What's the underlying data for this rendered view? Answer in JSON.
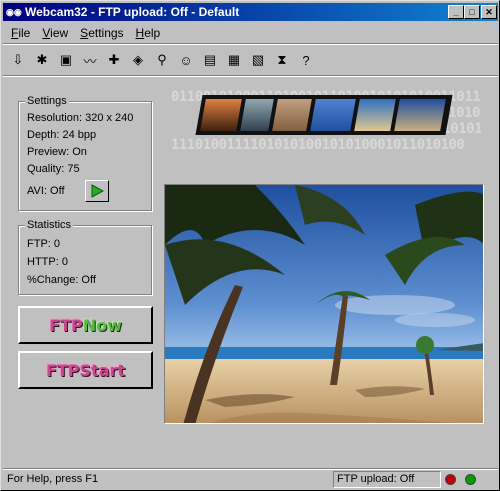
{
  "window": {
    "title": "Webcam32 - FTP upload: Off - Default"
  },
  "title_buttons": {
    "minimize": "_",
    "maximize": "□",
    "close": "✕"
  },
  "menu": {
    "items": [
      {
        "underline": "F",
        "rest": "ile"
      },
      {
        "underline": "V",
        "rest": "iew"
      },
      {
        "underline": "S",
        "rest": "ettings"
      },
      {
        "underline": "H",
        "rest": "elp"
      }
    ]
  },
  "toolbar": {
    "icons": [
      "download-icon",
      "bluetooth-icon",
      "save-icon",
      "wave-icon",
      "plus-cross-icon",
      "palette-icon",
      "magnifier-icon",
      "smiley-icon",
      "edit-icon",
      "filmstrip-icon",
      "screen-icon",
      "hourglass-icon",
      "help-icon"
    ],
    "glyphs": [
      "⇩",
      "✱",
      "▣",
      "〰",
      "✚",
      "◈",
      "⚲",
      "☺",
      "▤",
      "▦",
      "▧",
      "⧗",
      "?"
    ]
  },
  "settings": {
    "label": "Settings",
    "resolution": "Resolution: 320 x 240",
    "depth": "Depth: 24 bpp",
    "preview": "Preview: On",
    "quality": "Quality: 75",
    "avi": "AVI: Off"
  },
  "statistics": {
    "label": "Statistics",
    "ftp": "FTP: 0",
    "http": "HTTP: 0",
    "change": "%Change: Off"
  },
  "buttons": {
    "ftp_now_a": "FTP ",
    "ftp_now_b": "Now",
    "ftp_start_a": "FTP ",
    "ftp_start_b": "Start"
  },
  "banner": {
    "binary_rows": [
      "011001010001101001011010010101010011011",
      "0101010100110101001010010100100101",
      "001010100101010110101001001010001",
      "1110100111101010100101010001011010100"
    ]
  },
  "status": {
    "help": "For Help, press F1",
    "ftp": "FTP upload: Off",
    "led_colors": {
      "red": "#c00000",
      "green": "#00a000"
    }
  }
}
